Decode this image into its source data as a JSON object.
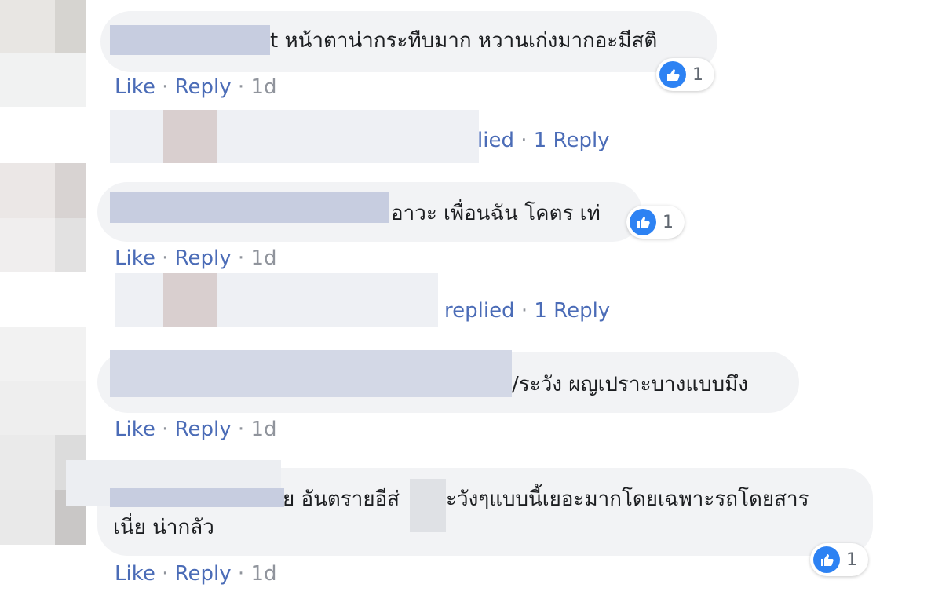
{
  "actions": {
    "like": "Like",
    "reply": "Reply",
    "separator": "·"
  },
  "comments": [
    {
      "text": "t หน้าตาน่ากระทืบมาก หวานเก่งมากอะมีสติ",
      "time": "1d",
      "reaction_count": "1",
      "replies_summary": {
        "prefix": "lied",
        "count_label": "1 Reply"
      }
    },
    {
      "text": "อาวะ เพื่อนฉัน โคตร เท่",
      "time": "1d",
      "reaction_count": "1",
      "replies_summary": {
        "prefix": "replied",
        "count_label": "1 Reply"
      }
    },
    {
      "text": "/ระวัง ผญเปราะบางแบบมึง",
      "time": "1d"
    },
    {
      "text_line1": "ย อันตรายอีส่",
      "text_line1b": "ะวังๆแบบนี้เยอะมากโดยเฉพาะรถโดยสาร",
      "text_line2": "เนี่ย น่ากลัว",
      "time": "1d",
      "reaction_count": "1"
    }
  ],
  "colors": {
    "bubble": "#f2f3f5",
    "link": "#4b6cb7",
    "muted": "#90949c",
    "like_blue": "#2d82f3"
  }
}
